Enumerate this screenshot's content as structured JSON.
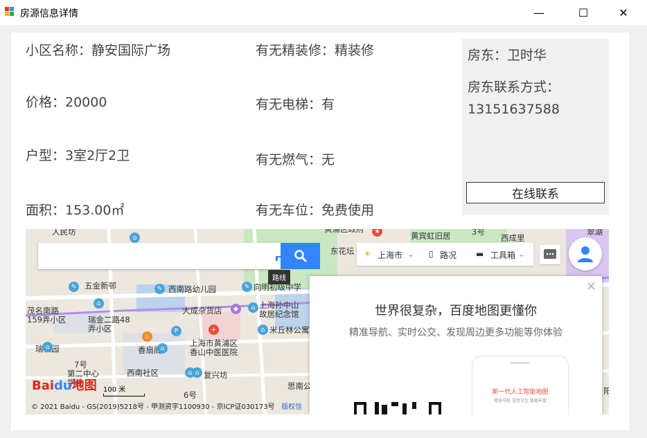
{
  "window": {
    "title": "房源信息详情",
    "minimize": "—",
    "maximize": "☐",
    "close": "✕"
  },
  "details": {
    "community": "小区名称：静安国际广场",
    "price": "价格：20000",
    "layout": "户型：3室2厅2卫",
    "area": "面积：153.00㎡",
    "decoration": "有无精装修：精装修",
    "elevator": "有无电梯：有",
    "gas": "有无燃气：无",
    "parking": "有无车位：免费使用"
  },
  "owner": {
    "name": "房东：卫时华",
    "contact_label": "房东联系方式：",
    "phone": "13151637588",
    "contact_button": "在线联系"
  },
  "map": {
    "route_tip": "路线",
    "city": "上海市",
    "traffic": "路况",
    "toolbox": "工具箱",
    "pois": [
      "人民坊",
      "五金新邨",
      "西南路幼儿园",
      "向明初级中学",
      "茂名南路",
      "159弄小区",
      "大成杂货店",
      "上海孙中山故居纪念馆",
      "瑞金二路48弄小区",
      "米丘林公寓",
      "瑞福园",
      "香扇阁",
      "上海市黄浦区香山中医医院",
      "7号",
      "第二中心学校",
      "西南社区",
      "复兴坊",
      "6号",
      "思南公",
      "黄宾虹旧居",
      "西成里",
      "3号",
      "东花坛",
      "黄浦区政府",
      "翠湖",
      "阳"
    ],
    "promo_title": "世界很复杂，百度地图更懂你",
    "promo_sub": "精准导航、实时公交、发现周边更多功能等你体验",
    "phone_title": "新一代人工智能地图",
    "phone_sub": "精准导航  语音交互  数据丰富",
    "scale": "100 米",
    "copyright": "© 2021 Baidu - GS(2019)5218号 - 甲测资字1100930 - 京ICP证030173号",
    "copyright_link": "版权信",
    "logo_bai": "Bai",
    "logo_du": "du",
    "logo_map": "地图"
  },
  "colors": {
    "accent": "#3385ff",
    "pin_blue": "#4aa3d8",
    "pin_purple": "#a77bd8",
    "pin_orange": "#f08a2c",
    "pin_red": "#e84d3d",
    "park_green": "#c9e8c2",
    "building_blue": "#bcd3ea",
    "road_purple": "#b18cf0"
  }
}
